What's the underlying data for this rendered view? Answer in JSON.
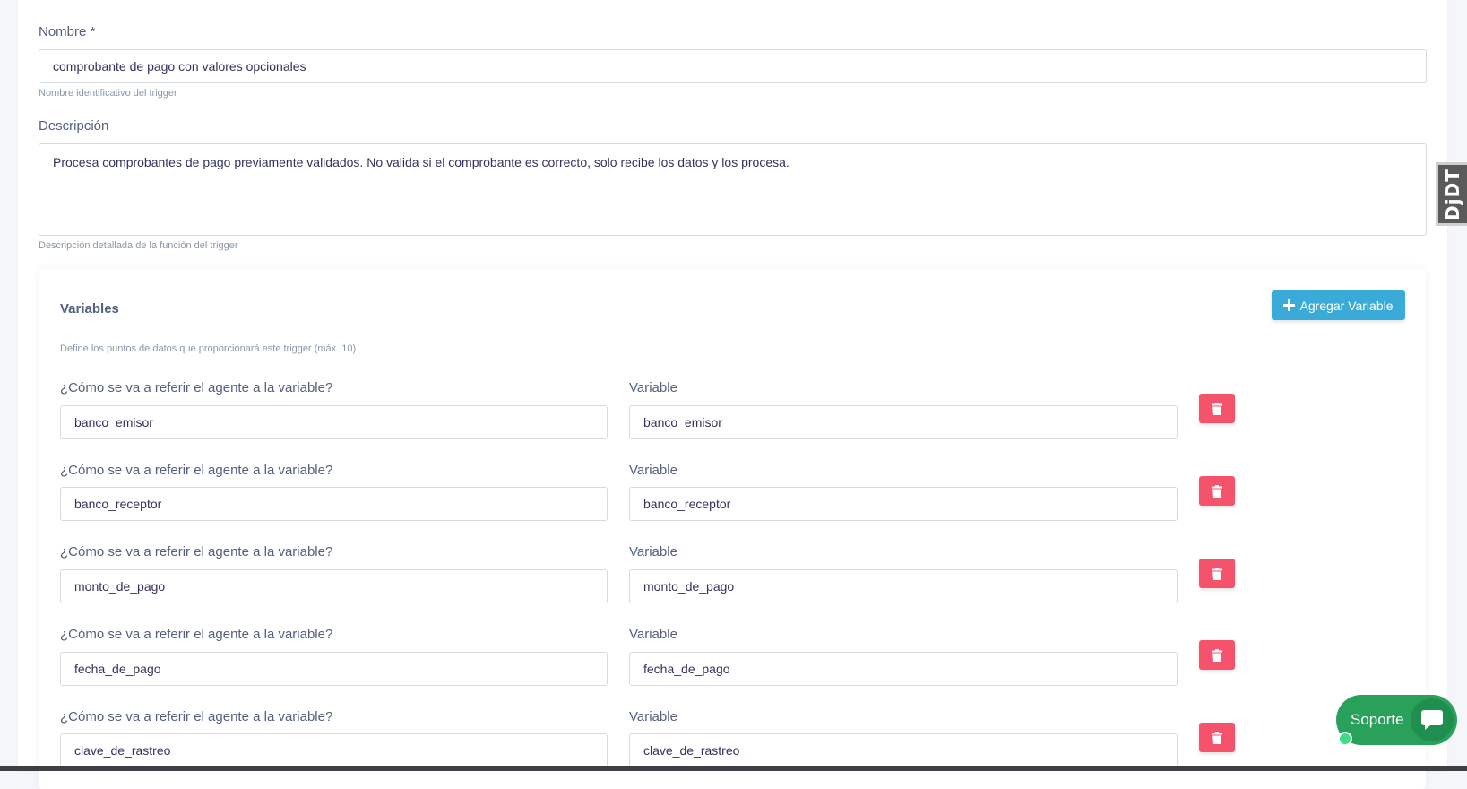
{
  "form": {
    "name_label": "Nombre *",
    "name_value": "comprobante de pago con valores opcionales",
    "name_help": "Nombre identificativo del trigger",
    "desc_label": "Descripción",
    "desc_value": "Procesa comprobantes de pago previamente validados. No valida si el comprobante es correcto, solo recibe los datos y los procesa.",
    "desc_help": "Descripción detallada de la función del trigger"
  },
  "variables": {
    "title": "Variables",
    "add_button": "Agregar Variable",
    "help": "Define los puntos de datos que proporcionará este trigger (máx. 10).",
    "alias_label": "¿Cómo se va a referir el agente a la variable?",
    "var_label": "Variable",
    "rows": [
      {
        "alias": "banco_emisor",
        "variable": "banco_emisor"
      },
      {
        "alias": "banco_receptor",
        "variable": "banco_receptor"
      },
      {
        "alias": "monto_de_pago",
        "variable": "monto_de_pago"
      },
      {
        "alias": "fecha_de_pago",
        "variable": "fecha_de_pago"
      },
      {
        "alias": "clave_de_rastreo",
        "variable": "clave_de_rastreo"
      }
    ]
  },
  "debug_toolbar": {
    "label": "DjDT"
  },
  "support": {
    "label": "Soporte"
  },
  "colors": {
    "accent": "#3aabd8",
    "danger": "#f5536c",
    "support": "#29a15b"
  }
}
